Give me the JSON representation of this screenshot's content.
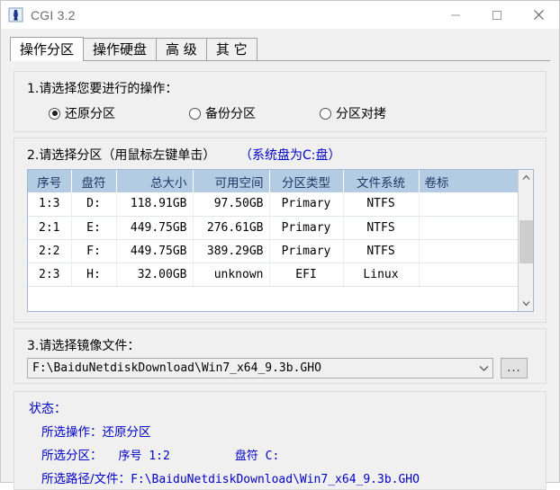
{
  "window": {
    "title": "CGI 3.2",
    "icon": "app-icon",
    "controls": {
      "minimize": "minimize-icon",
      "maximize": "maximize-icon",
      "close": "close-icon"
    }
  },
  "tabs": [
    {
      "label": "操作分区",
      "active": true
    },
    {
      "label": "操作硬盘",
      "active": false
    },
    {
      "label": "高 级",
      "active": false
    },
    {
      "label": "其 它",
      "active": false
    }
  ],
  "section1": {
    "label": "1.请选择您要进行的操作：",
    "options": [
      {
        "label": "还原分区",
        "checked": true
      },
      {
        "label": "备份分区",
        "checked": false
      },
      {
        "label": "分区对拷",
        "checked": false
      }
    ]
  },
  "section2": {
    "label": "2.请选择分区（用鼠标左键单击）",
    "note": "（系统盘为C:盘）",
    "columns": [
      "序号",
      "盘符",
      "总大小",
      "可用空间",
      "分区类型",
      "文件系统",
      "卷标"
    ],
    "rows": [
      {
        "index": "1:3",
        "drive": "D:",
        "size": "118.91GB",
        "free": "97.50GB",
        "type": "Primary",
        "fs": "NTFS",
        "volume": ""
      },
      {
        "index": "2:1",
        "drive": "E:",
        "size": "449.75GB",
        "free": "276.61GB",
        "type": "Primary",
        "fs": "NTFS",
        "volume": ""
      },
      {
        "index": "2:2",
        "drive": "F:",
        "size": "449.75GB",
        "free": "389.29GB",
        "type": "Primary",
        "fs": "NTFS",
        "volume": ""
      },
      {
        "index": "2:3",
        "drive": "H:",
        "size": "32.00GB",
        "free": "unknown",
        "type": "EFI",
        "fs": "Linux",
        "volume": ""
      }
    ],
    "scrollbar": {
      "up": "chevron-up-icon",
      "down": "chevron-down-icon"
    }
  },
  "section3": {
    "label": "3.请选择镜像文件：",
    "image_path": "F:\\BaiduNetdiskDownload\\Win7_x64_9.3b.GHO",
    "browse_label": "...",
    "dropdown_icon": "chevron-down-icon"
  },
  "status": {
    "title": "状态：",
    "operation_label": "所选操作：",
    "operation_value": "还原分区",
    "partition_label": "所选分区：",
    "partition_index_label": "序号",
    "partition_index_value": "1:2",
    "partition_drive_label": "盘符",
    "partition_drive_value": "C:",
    "path_label": "所选路径/文件：",
    "path_value": "F:\\BaiduNetdiskDownload\\Win7_x64_9.3b.GHO"
  },
  "colors": {
    "accent_blue": "#0000c8",
    "header_blue": "#b4cbe4",
    "header_text": "#1f3864"
  }
}
